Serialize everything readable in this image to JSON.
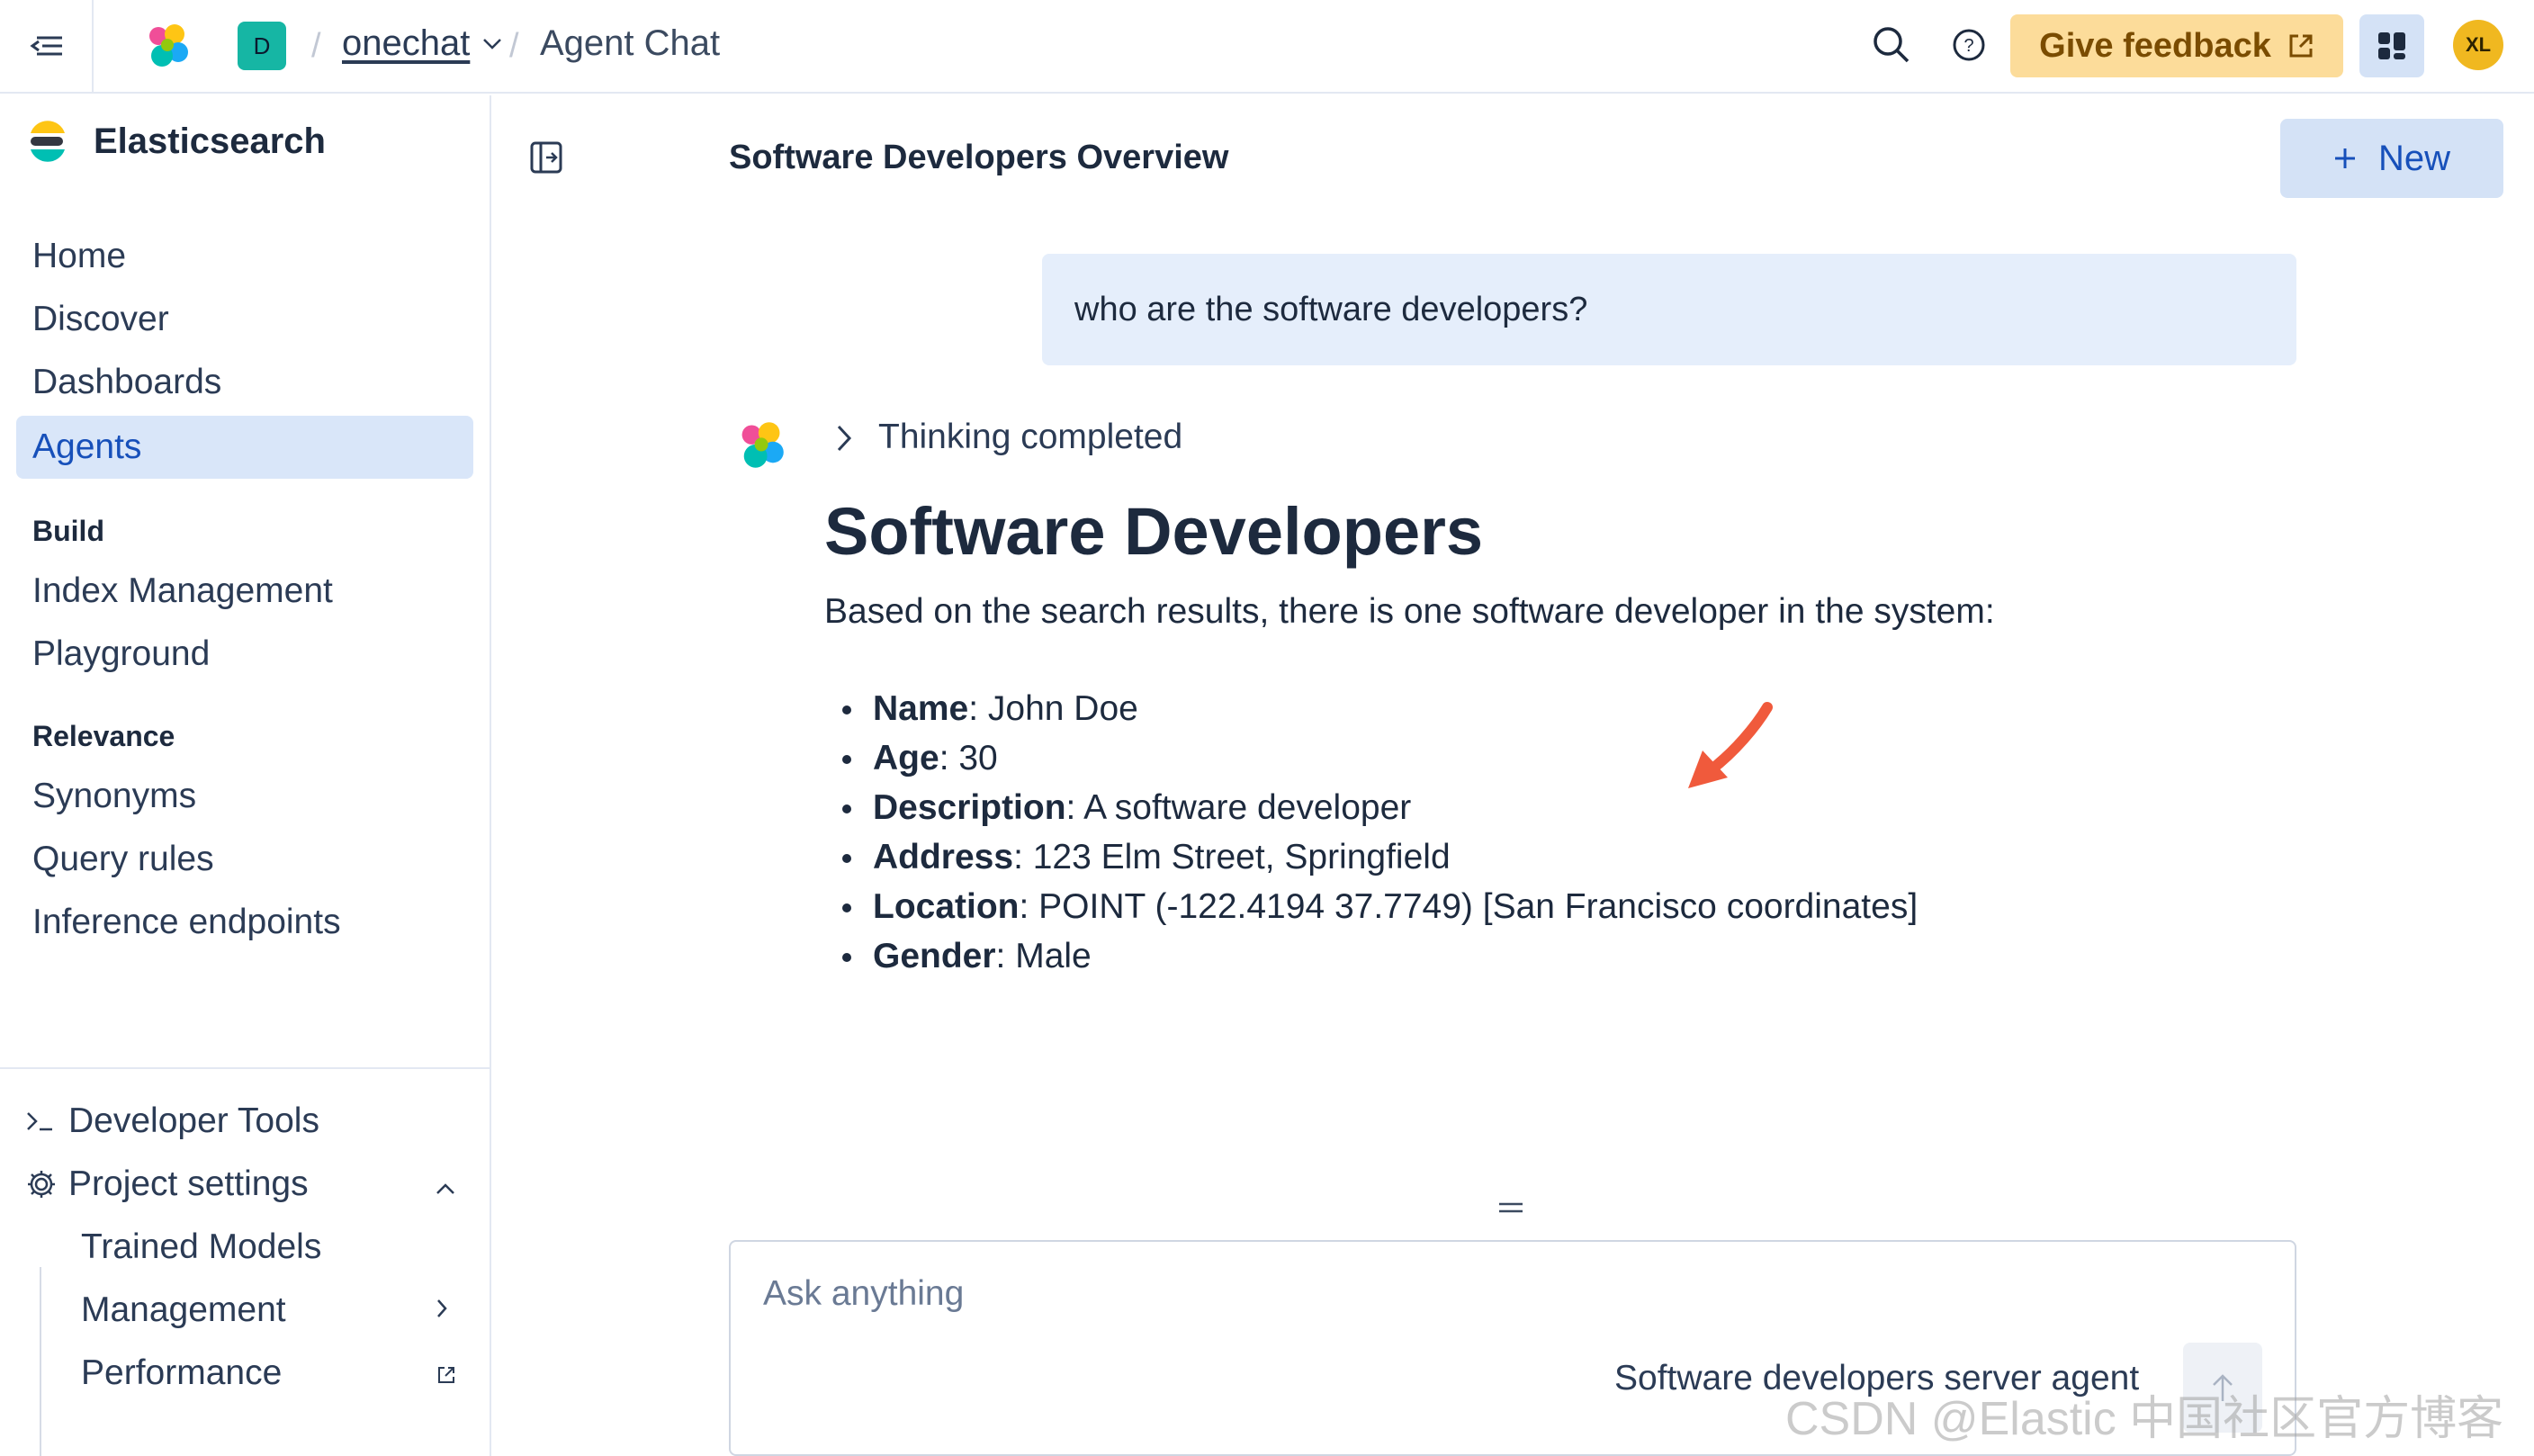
{
  "header": {
    "space_initial": "D",
    "breadcrumb_project": "onechat",
    "breadcrumb_current": "Agent Chat",
    "feedback_label": "Give feedback",
    "user_initials": "XL"
  },
  "sidebar": {
    "brand": "Elasticsearch",
    "nav": [
      {
        "label": "Home"
      },
      {
        "label": "Discover"
      },
      {
        "label": "Dashboards"
      },
      {
        "label": "Agents",
        "active": true
      }
    ],
    "build_title": "Build",
    "build_items": [
      {
        "label": "Index Management"
      },
      {
        "label": "Playground"
      }
    ],
    "relevance_title": "Relevance",
    "relevance_items": [
      {
        "label": "Synonyms"
      },
      {
        "label": "Query rules"
      },
      {
        "label": "Inference endpoints"
      }
    ],
    "footer": {
      "developer_tools": "Developer Tools",
      "project_settings": "Project settings",
      "sub_items": [
        {
          "label": "Trained Models"
        },
        {
          "label": "Management"
        },
        {
          "label": "Performance"
        }
      ]
    }
  },
  "conversation": {
    "title": "Software Developers Overview",
    "new_label": "New",
    "user_message": "who are the software developers?",
    "thinking_label": "Thinking completed",
    "answer": {
      "heading": "Software Developers",
      "intro": "Based on the search results, there is one software developer in the system:",
      "fields": [
        {
          "key": "Name",
          "value": ": John Doe"
        },
        {
          "key": "Age",
          "value": ": 30"
        },
        {
          "key": "Description",
          "value": ": A software developer"
        },
        {
          "key": "Address",
          "value": ": 123 Elm Street, Springfield"
        },
        {
          "key": "Location",
          "value": ": POINT (-122.4194 37.7749) [San Francisco coordinates]"
        },
        {
          "key": "Gender",
          "value": ": Male"
        }
      ]
    }
  },
  "input": {
    "placeholder": "Ask anything",
    "agent_name": "Software developers server agent"
  },
  "watermark": "CSDN @Elastic 中国社区官方博客",
  "colors": {
    "accent": "#1750ba",
    "active_bg": "#d9e6f9",
    "feedback_bg": "#fcdc9a",
    "annotation_arrow": "#f05a3c"
  }
}
